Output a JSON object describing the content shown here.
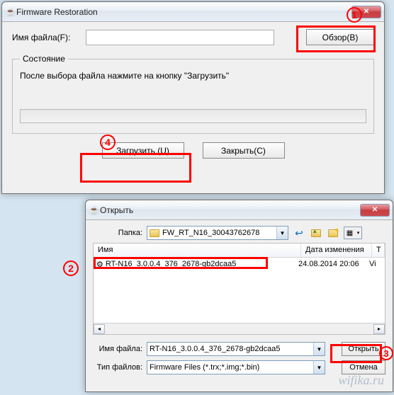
{
  "markers": {
    "m1": "1",
    "m2": "2",
    "m3": "3",
    "m4": "4"
  },
  "firmware": {
    "title": "Firmware Restoration",
    "filename_label": "Имя файла(F):",
    "filename_value": "",
    "browse_label": "Обзор(B)",
    "status_legend": "Состояние",
    "status_text": "После выбора файла нажмите на кнопку \"Загрузить\"",
    "upload_label": "Загрузить (U)",
    "close_label": "Закрыть(C)"
  },
  "open_dialog": {
    "title": "Открыть",
    "folder_label": "Папка:",
    "folder_value": "FW_RT_N16_30043762678",
    "columns": {
      "name": "Имя",
      "date": "Дата изменения",
      "type": "Т"
    },
    "files": [
      {
        "name": "RT-N16_3.0.0.4_376_2678-gb2dcaa5",
        "date": "24.08.2014 20:06",
        "type": "Vi"
      }
    ],
    "filename_label": "Имя файла:",
    "filename_value": "RT-N16_3.0.0.4_376_2678-gb2dcaa5",
    "filetype_label": "Тип файлов:",
    "filetype_value": "Firmware Files (*.trx;*.img;*.bin)",
    "open_btn": "Открыть",
    "cancel_btn": "Отмена"
  },
  "watermark": "wifika.ru"
}
